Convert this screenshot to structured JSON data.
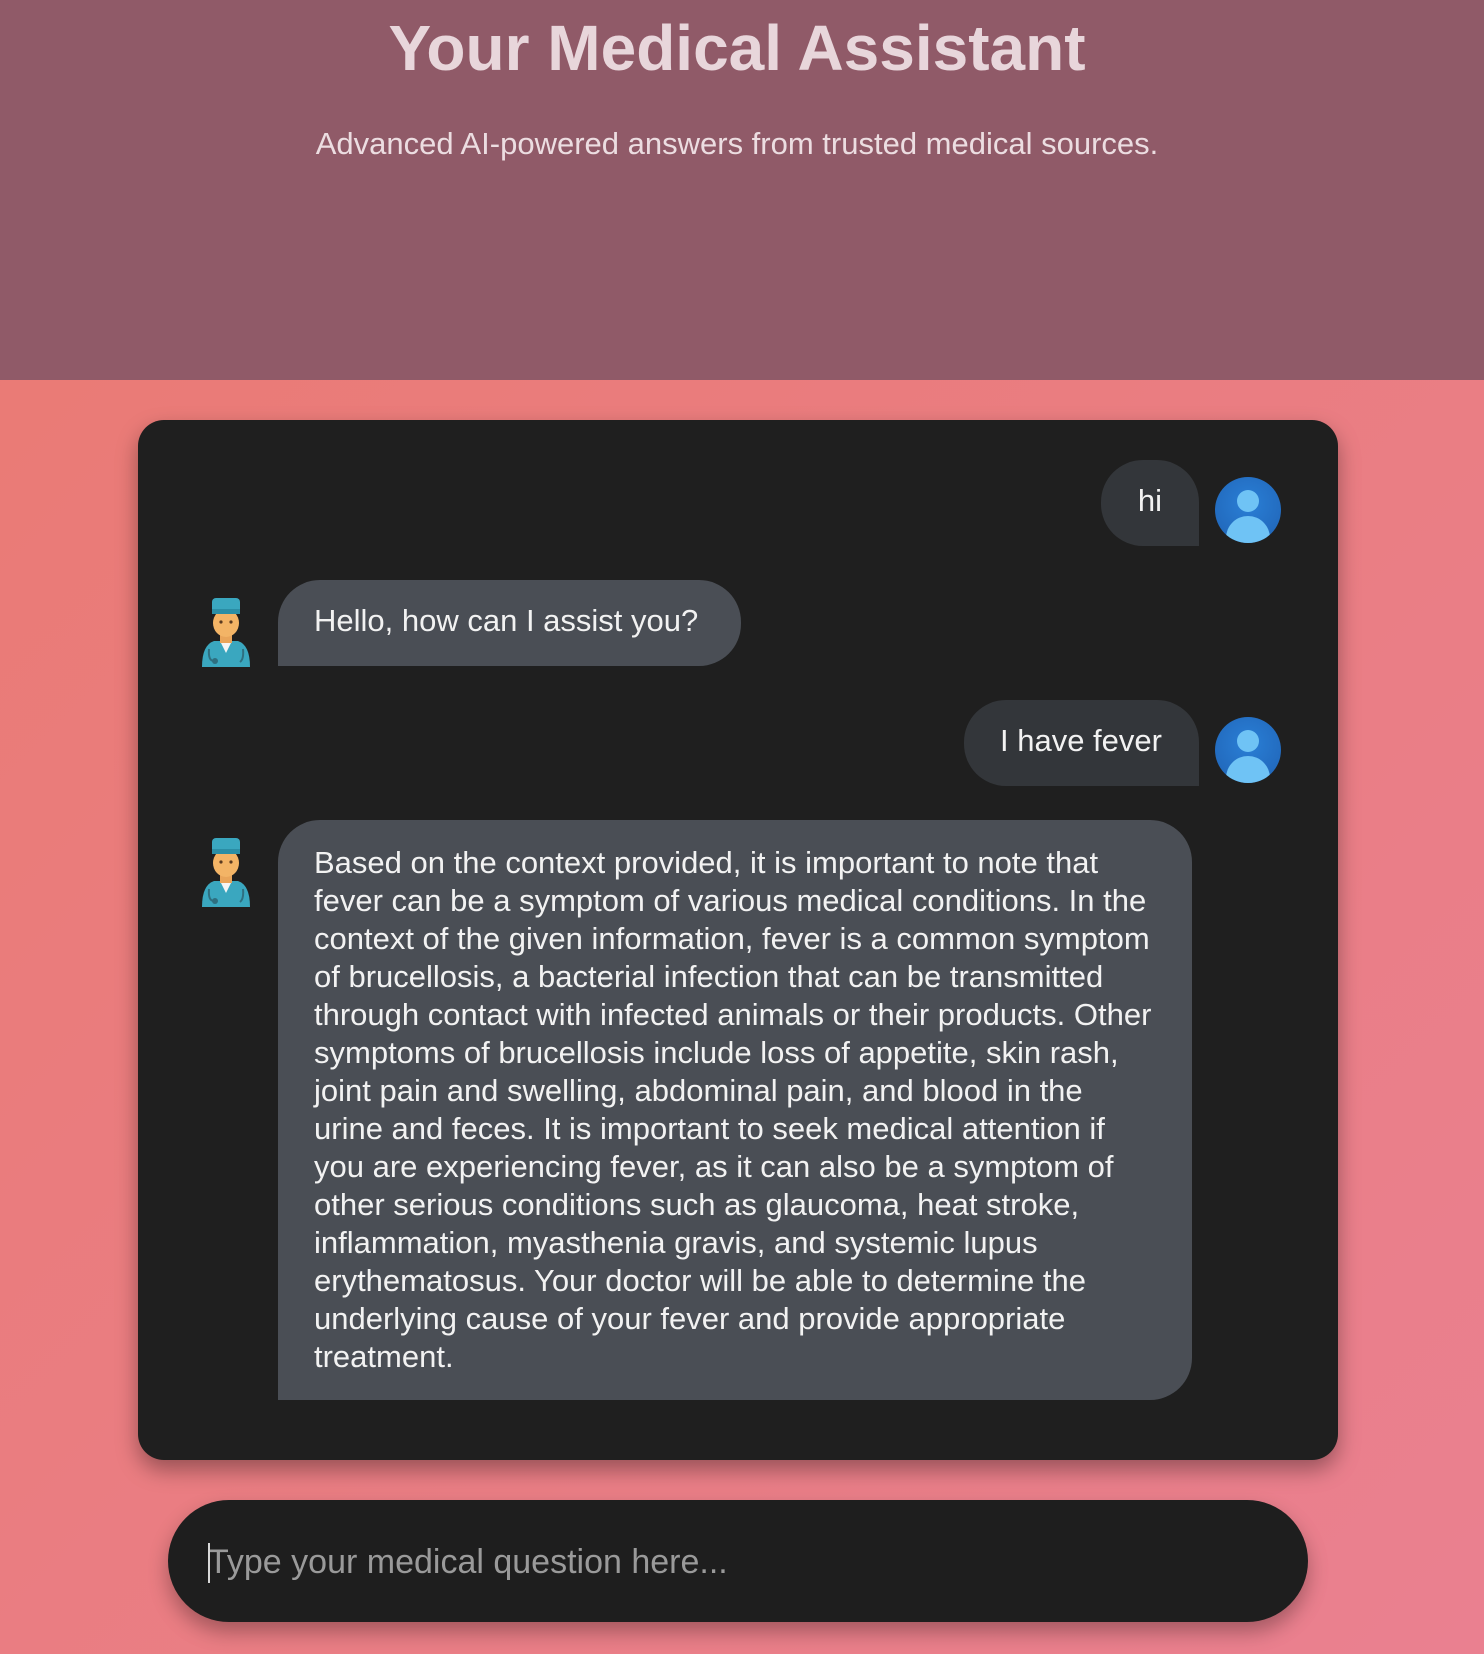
{
  "header": {
    "title": "Your Medical Assistant",
    "subtitle": "Advanced AI-powered answers from trusted medical sources."
  },
  "messages": [
    {
      "role": "user",
      "text": "hi"
    },
    {
      "role": "bot",
      "text": "Hello, how can I assist you?"
    },
    {
      "role": "user",
      "text": "I have fever"
    },
    {
      "role": "bot",
      "text": "Based on the context provided, it is important to note that fever can be a symptom of various medical conditions. In the context of the given information, fever is a common symptom of brucellosis, a bacterial infection that can be transmitted through contact with infected animals or their products. Other symptoms of brucellosis include loss of appetite, skin rash, joint pain and swelling, abdominal pain, and blood in the urine and feces. It is important to seek medical attention if you are experiencing fever, as it can also be a symptom of other serious conditions such as glaucoma, heat stroke, inflammation, myasthenia gravis, and systemic lupus erythematosus. Your doctor will be able to determine the underlying cause of your fever and provide appropriate treatment."
    }
  ],
  "input": {
    "placeholder": "Type your medical question here...",
    "value": ""
  },
  "icons": {
    "user_avatar": "user-avatar-icon",
    "bot_avatar": "doctor-avatar-icon"
  },
  "colors": {
    "header_bg": "#905a68",
    "page_bg_start": "#ea7a72",
    "page_bg_end": "#ea8090",
    "chat_bg": "#1f1f1f",
    "user_bubble": "#33363a",
    "bot_bubble": "#4a4e55",
    "user_avatar": "#2a7fd6"
  }
}
